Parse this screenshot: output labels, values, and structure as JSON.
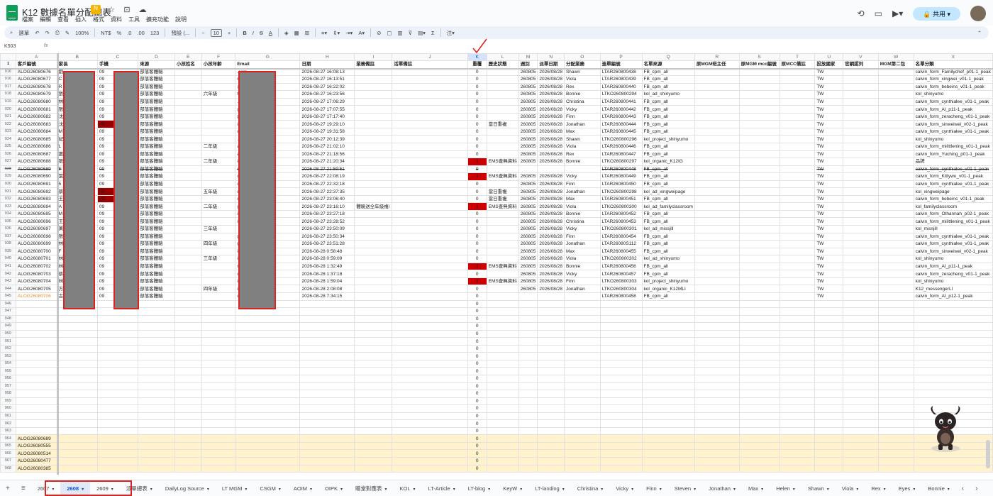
{
  "doc_title": "K12 數據名單分配總表",
  "menu": [
    "檔案",
    "編輯",
    "查看",
    "插入",
    "格式",
    "資料",
    "工具",
    "擴充功能",
    "說明"
  ],
  "share_label": "共用",
  "toolbar": {
    "search": "選單",
    "zoom": "100%",
    "currency": "NT$",
    "percent": "%",
    "dec1": ".0",
    "dec2": ".00",
    "num": "123",
    "font": "預設 (...",
    "font_size": "10"
  },
  "cell_ref": "K503",
  "fx": "fx",
  "columns": [
    "A",
    "B",
    "C",
    "D",
    "E",
    "F",
    "G",
    "H",
    "I",
    "J",
    "K",
    "L",
    "M",
    "N",
    "O",
    "P",
    "Q",
    "R",
    "S",
    "T",
    "U",
    "V",
    "W",
    "X"
  ],
  "header_row": {
    "num": "1",
    "cells": [
      "客戶編號",
      "家長",
      "手機",
      "來源",
      "小孩姓名",
      "小孩年齡",
      "Email",
      "日期",
      "業務備註",
      "活單備註",
      "重覆",
      "歷史狀態",
      "週別",
      "派單日期",
      "分配業務",
      "進單編號",
      "名單來源",
      "原MGM班主任",
      "原MGM mcc編號",
      "原MCC備註",
      "投放國家",
      "官網認列",
      "MGM第二包",
      "名單分類"
    ]
  },
  "rows": [
    {
      "num": "916",
      "a": "ALOG26080676",
      "b": "劉",
      "c": "09",
      "d": "部落客體驗",
      "e": "",
      "f": "",
      "g": ".com",
      "h": "2026-08-27 16:08:13",
      "i": "",
      "k": "0",
      "l": "",
      "m": "260805",
      "n": "2026/08/28",
      "o": "Shawn",
      "p": "LTAR260800438",
      "q": "FB_cpm_all",
      "u": "TW",
      "x": "calvin_form_Familychef_p01-1_peak"
    },
    {
      "num": "916",
      "a": "ALOG26080677",
      "b": "C",
      "c": "09",
      "d": "部落客體驗",
      "e": "",
      "f": "",
      "g": "mail.com",
      "h": "2026-08-27 16:13:51",
      "i": "",
      "k": "0",
      "l": "",
      "m": "260805",
      "n": "2026/08/28",
      "o": "Viola",
      "p": "LTAR260800439",
      "q": "FB_cpm_all",
      "u": "TW",
      "x": "calvin_form_xingwei_v01-1_peak"
    },
    {
      "num": "917",
      "a": "ALOG26080678",
      "b": "R",
      "c": "09",
      "d": "部落客體驗",
      "e": "",
      "f": "",
      "g": "@yahoo.com",
      "h": "2026-08-27 16:22:02",
      "i": "",
      "k": "0",
      "l": "",
      "m": "260805",
      "n": "2026/08/28",
      "o": "Rex",
      "p": "LTAR260800440",
      "q": "FB_cpm_all",
      "u": "TW",
      "x": "calvin_form_bebeins_v01-1_peak"
    },
    {
      "num": "918",
      "a": "ALOG26080679",
      "b": "張",
      "c": "09",
      "d": "部落客體驗",
      "e": "",
      "f": "六年級",
      "g": "hoo.com.tw",
      "h": "2026-08-27 16:23:56",
      "i": "",
      "k": "0",
      "l": "",
      "m": "260805",
      "n": "2026/08/28",
      "o": "Bonnie",
      "p": "LTKO260800294",
      "q": "kol_ad_shinyumo",
      "u": "TW",
      "x": "kol_shinyumo"
    },
    {
      "num": "919",
      "a": "ALOG26080680",
      "b": "林",
      "c": "09",
      "d": "部落客體驗",
      "e": "",
      "f": "",
      "g": ".com",
      "h": "2026-08-27 17:06:29",
      "i": "",
      "k": "0",
      "l": "",
      "m": "260805",
      "n": "2026/08/28",
      "o": "Christina",
      "p": "LTAR260800441",
      "q": "FB_cpm_all",
      "u": "TW",
      "x": "calvin_form_cynthialee_v01-1_peak"
    },
    {
      "num": "920",
      "a": "ALOG26080681",
      "b": "張",
      "c": "09",
      "d": "部落客體驗",
      "e": "",
      "f": "",
      "g": "gmail.com",
      "h": "2026-08-27 17:07:55",
      "i": "",
      "k": "0",
      "l": "",
      "m": "260805",
      "n": "2026/08/28",
      "o": "Vicky",
      "p": "LTAR260800442",
      "q": "FB_cpm_all",
      "u": "TW",
      "x": "calvin_form_AI_p11-1_peak"
    },
    {
      "num": "921",
      "a": "ALOG26080682",
      "b": "沈",
      "c": "09",
      "d": "部落客體驗",
      "e": "",
      "f": "",
      "g": "gmail.com",
      "h": "2026-08-27 17:17:40",
      "i": "",
      "k": "0",
      "l": "",
      "m": "260805",
      "n": "2026/08/28",
      "o": "Finn",
      "p": "LTAR260800443",
      "q": "FB_cpm_all",
      "u": "TW",
      "x": "calvin_form_zeracheng_v01-1_peak"
    },
    {
      "num": "922",
      "a": "ALOG26080683",
      "b": "沈",
      "c": "09",
      "cdark": true,
      "d": "部落客體驗",
      "e": "",
      "f": "",
      "g": "il.com",
      "h": "2026-08-27 19:29:10",
      "i": "",
      "k": "0",
      "l": "當日重複",
      "m": "260805",
      "n": "2026/08/28",
      "o": "Jonathan",
      "p": "LTAR260800444",
      "q": "FB_cpm_all",
      "u": "TW",
      "x": "calvin_form_sinweiwei_v02-1_peak"
    },
    {
      "num": "923",
      "a": "ALOG26080684",
      "b": "M",
      "c": "09",
      "d": "部落客體驗",
      "e": "",
      "f": "",
      "g": "o.com.tw",
      "h": "2026-08-27 19:31:58",
      "i": "",
      "k": "0",
      "l": "",
      "m": "260805",
      "n": "2026/08/28",
      "o": "Max",
      "p": "LTAR260800445",
      "q": "FB_cpm_all",
      "u": "TW",
      "x": "calvin_form_cynthialee_v01-1_peak"
    },
    {
      "num": "924",
      "a": "ALOG26080685",
      "b": "紀",
      "c": "09",
      "d": "部落客體驗",
      "e": "",
      "f": "",
      "g": ".com",
      "h": "2026-08-27 20:12:39",
      "i": "",
      "k": "0",
      "l": "",
      "m": "260805",
      "n": "2026/08/28",
      "o": "Shawn",
      "p": "LTKO260800296",
      "q": "kol_project_shinyumo",
      "u": "TW",
      "x": "kol_shinyumo"
    },
    {
      "num": "925",
      "a": "ALOG26080686",
      "b": "L",
      "c": "09",
      "d": "部落客體驗",
      "e": "",
      "f": "二年級",
      "g": "ahoo.com.tw",
      "h": "2026-08-27 21:02:10",
      "i": "",
      "k": "0",
      "l": "",
      "m": "260805",
      "n": "2026/08/28",
      "o": "Viola",
      "p": "LTAR260800446",
      "q": "FB_cpm_all",
      "u": "TW",
      "x": "calvin_form_milittlening_v01-1_peak"
    },
    {
      "num": "926",
      "a": "ALOG26080687",
      "b": "蕭",
      "c": "09",
      "d": "部落客體驗",
      "e": "",
      "f": "",
      "g": "ail.com",
      "h": "2026-08-27 21:18:56",
      "i": "",
      "k": "0",
      "l": "",
      "m": "260805",
      "n": "2026/08/28",
      "o": "Rex",
      "p": "LTAR260800447",
      "q": "FB_cpm_all",
      "u": "TW",
      "x": "calvin_form_Yuching_p01-1_peak"
    },
    {
      "num": "927",
      "a": "ALOG26080688",
      "b": "張",
      "c": "09",
      "d": "部落客體驗",
      "e": "",
      "f": "二年級",
      "g": "il.com",
      "h": "2026-08-27 21:20:34",
      "i": "",
      "k": "1",
      "kdup": true,
      "l": "EMS查無資料",
      "m": "260805",
      "n": "2026/08/28",
      "o": "Bonnie",
      "p": "LTKO260800297",
      "q": "kol_organic_K12IG",
      "u": "TW",
      "x": "品牌"
    },
    {
      "num": "928",
      "a": "ALOG26080689",
      "b": "F",
      "c": "09",
      "d": "部落客體驗",
      "e": "",
      "f": "",
      "g": "o.com.tw",
      "h": "2026-08-27 21:59:51",
      "i": "",
      "k": "0",
      "l": "",
      "m": "",
      "n": "",
      "o": "",
      "p": "LTAR260800448",
      "q": "FB_cpm_all",
      "u": "TW",
      "x": "calvin_form_cynthialee_v01-1_peak",
      "strike": true
    },
    {
      "num": "929",
      "a": "ALOG26080690",
      "b": "葉",
      "c": "09",
      "d": "部落客體驗",
      "e": "",
      "f": "",
      "g": "o.com.tw",
      "h": "2026-08-27 22:08:19",
      "i": "",
      "k": "1",
      "kdup": true,
      "l": "EMS查無資料",
      "m": "260805",
      "n": "2026/08/28",
      "o": "Vicky",
      "p": "LTAR260800449",
      "q": "FB_cpm_all",
      "u": "TW",
      "x": "calvin_form_Kittywu_v01-1_peak"
    },
    {
      "num": "930",
      "a": "ALOG26080691",
      "b": "5",
      "c": "09",
      "d": "部落客體驗",
      "e": "",
      "f": "",
      "g": "o.com.tw",
      "h": "2026-08-27 22:32:18",
      "i": "",
      "k": "0",
      "l": "",
      "m": "260805",
      "n": "2026/08/28",
      "o": "Finn",
      "p": "LTAR260800450",
      "q": "FB_cpm_all",
      "u": "TW",
      "x": "calvin_form_cynthialee_v01-1_peak"
    },
    {
      "num": "931",
      "a": "ALOG26080692",
      "b": "蔡",
      "c": "09",
      "cdark": true,
      "d": "部落客體驗",
      "e": "",
      "f": "五年級",
      "g": "com",
      "h": "2026-08-27 22:37:35",
      "i": "",
      "k": "0",
      "l": "當日重複",
      "m": "260805",
      "n": "2026/08/28",
      "o": "Jonathan",
      "p": "LTKO260800298",
      "q": "kol_ad_xingweipage",
      "u": "TW",
      "x": "kol_xingweipage"
    },
    {
      "num": "932",
      "a": "ALOG26080693",
      "b": "王",
      "c": "09",
      "cdark": true,
      "d": "部落客體驗",
      "e": "",
      "f": "",
      "g": "com",
      "h": "2026-08-27 23:06:40",
      "i": "",
      "k": "0",
      "l": "當日重複",
      "m": "260805",
      "n": "2026/08/28",
      "o": "Max",
      "p": "LTAR260800451",
      "q": "FB_cpm_all",
      "u": "TW",
      "x": "calvin_form_bebeins_v01-1_peak"
    },
    {
      "num": "933",
      "a": "ALOG26080694",
      "b": "A",
      "c": "09",
      "d": "部落客體驗",
      "e": "",
      "f": "二年級",
      "g": "gmail.com",
      "h": "2026-08-27 23:16:10",
      "i": "體驗送全年級複i",
      "k": "1",
      "kdup": true,
      "l": "EMS查無資料",
      "m": "260805",
      "n": "2026/08/28",
      "o": "Viola",
      "p": "LTKO260800300",
      "q": "kol_ad_familyclassroom",
      "u": "TW",
      "x": "kol_familyclassroom"
    },
    {
      "num": "934",
      "a": "ALOG26080695",
      "b": "M",
      "c": "09",
      "d": "部落客體驗",
      "e": "",
      "f": "",
      "g": "il.com",
      "h": "2026-08-27 23:27:18",
      "i": "",
      "k": "0",
      "l": "",
      "m": "260805",
      "n": "2026/08/28",
      "o": "Bonnie",
      "p": "LTAR260800452",
      "q": "FB_cpm_all",
      "u": "TW",
      "x": "calvin_form_Othannah_p02-1_peak"
    },
    {
      "num": "935",
      "a": "ALOG26080696",
      "b": "王",
      "c": "09",
      "d": "部落客體驗",
      "e": "",
      "f": "",
      "g": "il.com",
      "h": "2026-08-27 23:28:52",
      "i": "",
      "k": "0",
      "l": "",
      "m": "260805",
      "n": "2026/08/28",
      "o": "Christina",
      "p": "LTAR260800453",
      "q": "FB_cpm_all",
      "u": "TW",
      "x": "calvin_form_milittlening_v01-1_peak"
    },
    {
      "num": "936",
      "a": "ALOG26080697",
      "b": "黃",
      "c": "09",
      "d": "部落客體驗",
      "e": "",
      "f": "三年級",
      "g": "",
      "h": "2026-08-27 23:50:09",
      "i": "",
      "k": "0",
      "l": "",
      "m": "260805",
      "n": "2026/08/28",
      "o": "Vicky",
      "p": "LTKO260800301",
      "q": "kol_ad_missjill",
      "u": "TW",
      "x": "kol_missjill"
    },
    {
      "num": "937",
      "a": "ALOG26080698",
      "b": "張",
      "c": "09",
      "d": "部落客體驗",
      "e": "",
      "f": "",
      "g": "gmail.com",
      "h": "2026-08-27 23:50:34",
      "i": "",
      "k": "0",
      "l": "",
      "m": "260805",
      "n": "2026/08/28",
      "o": "Finn",
      "p": "LTAR260800454",
      "q": "FB_cpm_all",
      "u": "TW",
      "x": "calvin_form_cynthialee_v01-1_peak"
    },
    {
      "num": "938",
      "a": "ALOG26080699",
      "b": "林",
      "c": "09",
      "d": "部落客體驗",
      "e": "",
      "f": "四年級",
      "g": "gmail.com",
      "h": "2026-08-27 23:51:28",
      "i": "",
      "k": "0",
      "l": "",
      "m": "260805",
      "n": "2026/08/28",
      "o": "Jonathan",
      "p": "LTAR26080S112",
      "q": "FB_cpm_all",
      "u": "TW",
      "x": "calvin_form_cynthialee_v01-1_peak"
    },
    {
      "num": "939",
      "a": "ALOG26080700",
      "b": "F",
      "c": "09",
      "d": "部落客體驗",
      "e": "",
      "f": "",
      "g": "il.com",
      "h": "2026-08-28 0:58:48",
      "i": "",
      "k": "0",
      "l": "",
      "m": "260805",
      "n": "2026/08/28",
      "o": "Max",
      "p": "LTAR260800455",
      "q": "FB_cpm_all",
      "u": "TW",
      "x": "calvin_form_sinweiwei_v02-1_peak"
    },
    {
      "num": "940",
      "a": "ALOG26080701",
      "b": "林",
      "c": "09",
      "d": "部落客體驗",
      "e": "",
      "f": "三年級",
      "g": "il.com",
      "h": "2026-08-28 0:59:09",
      "i": "",
      "k": "0",
      "l": "",
      "m": "260805",
      "n": "2026/08/28",
      "o": "Viola",
      "p": "LTKO260800302",
      "q": "kol_ad_shinyumo",
      "u": "TW",
      "x": "kol_shinyumo"
    },
    {
      "num": "941",
      "a": "ALOG26080702",
      "b": "林",
      "c": "09",
      "d": "部落客體驗",
      "e": "",
      "f": "",
      "g": "mail.com",
      "h": "2026-08-28 1:32:49",
      "i": "",
      "k": "1",
      "kdup": true,
      "l": "EMS查無資料",
      "m": "260805",
      "n": "2026/08/28",
      "o": "Bonnie",
      "p": "LTAR260800456",
      "q": "FB_cpm_all",
      "u": "TW",
      "x": "calvin_form_AI_p11-1_peak"
    },
    {
      "num": "942",
      "a": "ALOG26080703",
      "b": "蔡",
      "c": "09",
      "d": "部落客體驗",
      "e": "",
      "f": "",
      "g": "o.com",
      "h": "2026-08-28 1:37:18",
      "i": "",
      "k": "0",
      "l": "",
      "m": "260805",
      "n": "2026/08/28",
      "o": "Vicky",
      "p": "LTAR260800457",
      "q": "FB_cpm_all",
      "u": "TW",
      "x": "calvin_form_zeracheng_v01-1_peak"
    },
    {
      "num": "943",
      "a": "ALOG26080704",
      "b": "林",
      "c": "09",
      "d": "部落客體驗",
      "e": "",
      "f": "",
      "g": "il.tw",
      "h": "2026-08-28 1:59:04",
      "i": "",
      "k": "1",
      "kdup": true,
      "l": "EMS查無資料",
      "m": "260805",
      "n": "2026/08/28",
      "o": "Finn",
      "p": "LTKO260800303",
      "q": "kol_project_shinyumo",
      "u": "TW",
      "x": "kol_shinyumo"
    },
    {
      "num": "944",
      "a": "ALOG26080705",
      "b": "方",
      "c": "09",
      "d": "部落客體驗",
      "e": "",
      "f": "四年級",
      "g": "il.com",
      "h": "2026-08-28 2:08:08",
      "i": "",
      "k": "0",
      "l": "",
      "m": "260805",
      "n": "2026/08/28",
      "o": "Jonathan",
      "p": "LTKO260800304",
      "q": "kol_organic_K12MLI",
      "u": "TW",
      "x": "K12_messengerLI"
    },
    {
      "num": "945",
      "a": "ALOG26080706",
      "aorange": true,
      "b": "古",
      "c": "09",
      "d": "部落客體驗",
      "e": "",
      "f": "",
      "g": "o.com.tw",
      "h": "2026-08-28 7:34:15",
      "i": "",
      "k": "0",
      "l": "",
      "m": "",
      "n": "",
      "o": "",
      "p": "LTAR260800458",
      "q": "FB_cpm_all",
      "u": "TW",
      "x": "calvin_form_AI_p12-1_peak"
    }
  ],
  "empty_rows": [
    "946",
    "947",
    "948",
    "949",
    "950",
    "951",
    "952",
    "953",
    "954",
    "955",
    "956",
    "957",
    "958",
    "959",
    "960",
    "961",
    "962",
    "963"
  ],
  "bottom_rows": [
    {
      "num": "964",
      "a": "ALOG26080689"
    },
    {
      "num": "965",
      "a": "ALOG26080555"
    },
    {
      "num": "966",
      "a": "ALOG26080514"
    },
    {
      "num": "967",
      "a": "ALOG26080477"
    },
    {
      "num": "968",
      "a": "ALOG26080385"
    }
  ],
  "tabs": [
    {
      "label": "2607",
      "dd": true
    },
    {
      "label": "2608",
      "dd": true,
      "active": true
    },
    {
      "label": "2609",
      "dd": true
    },
    {
      "label": "派單總表",
      "dd": true
    },
    {
      "label": "DailyLog Source",
      "dd": true
    },
    {
      "label": "LT MGM",
      "dd": true
    },
    {
      "label": "CSGM",
      "dd": true
    },
    {
      "label": "AOIM",
      "dd": true
    },
    {
      "label": "OIPK",
      "dd": true
    },
    {
      "label": "贈堂對應表",
      "dd": true
    },
    {
      "label": "KOL",
      "dd": true
    },
    {
      "label": "LT-Article",
      "dd": true
    },
    {
      "label": "LT-blog",
      "dd": true
    },
    {
      "label": "KeyW",
      "dd": true
    },
    {
      "label": "LT-landing",
      "dd": true
    },
    {
      "label": "Christina",
      "dd": true
    },
    {
      "label": "Vicky",
      "dd": true
    },
    {
      "label": "Finn",
      "dd": true
    },
    {
      "label": "Steven",
      "dd": true
    },
    {
      "label": "Jonathan",
      "dd": true
    },
    {
      "label": "Max",
      "dd": true
    },
    {
      "label": "Helen",
      "dd": true
    },
    {
      "label": "Shawn",
      "dd": true
    },
    {
      "label": "Viola",
      "dd": true
    },
    {
      "label": "Rex",
      "dd": true
    },
    {
      "label": "Eyes",
      "dd": true
    },
    {
      "label": "Bonnie",
      "dd": true
    }
  ],
  "colors": {
    "accent": "#0b57d0",
    "dup_red": "#cc0000",
    "dark_red": "#990000",
    "highlight": "#fff2cc",
    "annotation": "#dd2222"
  }
}
